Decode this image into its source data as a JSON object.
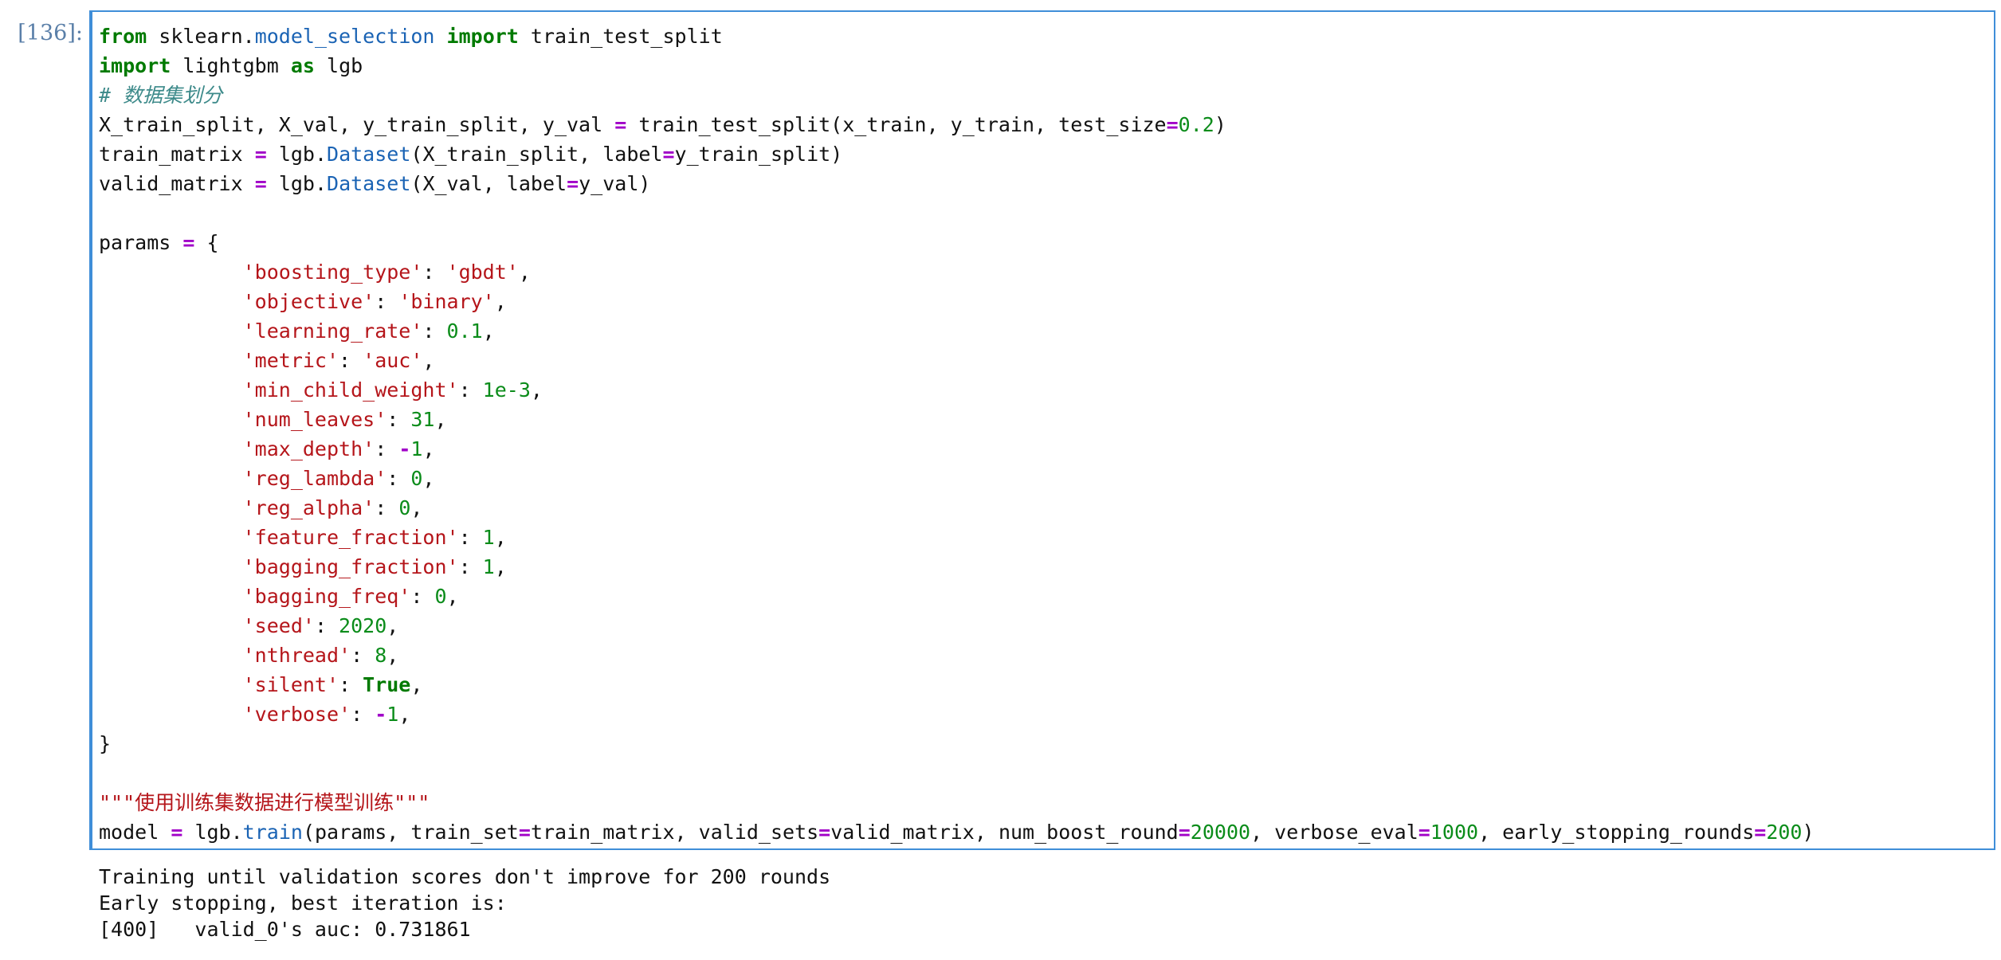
{
  "cell": {
    "prompt": "[136]:",
    "line1": {
      "kw_from": "from",
      "mod_a": "sklearn.",
      "mod_b": "model_selection",
      "kw_import": "import",
      "name": "train_test_split"
    },
    "line2": {
      "kw_import": "import",
      "name": "lightgbm",
      "kw_as": "as",
      "alias": "lgb"
    },
    "line3": {
      "comment": "# 数据集划分"
    },
    "line4": {
      "a": "X_train_split, X_val, y_train_split, y_val",
      "eq": "=",
      "b": "train_test_split(x_train, y_train, test_size",
      "eq2": "=",
      "num": "0.2",
      "c": ")"
    },
    "line5": {
      "a": "train_matrix",
      "eq": "=",
      "b": "lgb.",
      "fn": "Dataset",
      "c": "(X_train_split, label",
      "eq2": "=",
      "d": "y_train_split)"
    },
    "line6": {
      "a": "valid_matrix",
      "eq": "=",
      "b": "lgb.",
      "fn": "Dataset",
      "c": "(X_val, label",
      "eq2": "=",
      "d": "y_val)"
    },
    "params_head": {
      "a": "params",
      "eq": "=",
      "b": "{"
    },
    "params": [
      {
        "key": "'boosting_type'",
        "val": "'gbdt'",
        "type": "str"
      },
      {
        "key": "'objective'",
        "val": "'binary'",
        "type": "str"
      },
      {
        "key": "'learning_rate'",
        "val": "0.1",
        "type": "num"
      },
      {
        "key": "'metric'",
        "val": "'auc'",
        "type": "str"
      },
      {
        "key": "'min_child_weight'",
        "val": "1e-3",
        "type": "num"
      },
      {
        "key": "'num_leaves'",
        "val": "31",
        "type": "num"
      },
      {
        "key": "'max_depth'",
        "val": "-1",
        "type": "neg"
      },
      {
        "key": "'reg_lambda'",
        "val": "0",
        "type": "num"
      },
      {
        "key": "'reg_alpha'",
        "val": "0",
        "type": "num"
      },
      {
        "key": "'feature_fraction'",
        "val": "1",
        "type": "num"
      },
      {
        "key": "'bagging_fraction'",
        "val": "1",
        "type": "num"
      },
      {
        "key": "'bagging_freq'",
        "val": "0",
        "type": "num"
      },
      {
        "key": "'seed'",
        "val": "2020",
        "type": "num"
      },
      {
        "key": "'nthread'",
        "val": "8",
        "type": "num"
      },
      {
        "key": "'silent'",
        "val": "True",
        "type": "kw"
      },
      {
        "key": "'verbose'",
        "val": "-1",
        "type": "neg"
      }
    ],
    "params_close": "}",
    "docstring": "\"\"\"使用训练集数据进行模型训练\"\"\"",
    "train_line": {
      "a": "model",
      "eq": "=",
      "b": "lgb.",
      "fn": "train",
      "c": "(params, train_set",
      "eq2": "=",
      "d": "train_matrix, valid_sets",
      "eq3": "=",
      "e": "valid_matrix, num_boost_round",
      "eq4": "=",
      "n1": "20000",
      "f": ", verbose_eval",
      "eq5": "=",
      "n2": "1000",
      "g": ", early_stopping_rounds",
      "eq6": "=",
      "n3": "200",
      "h": ")"
    }
  },
  "output": {
    "lines": [
      "Training until validation scores don't improve for 200 rounds",
      "Early stopping, best iteration is:",
      "[400]\tvalid_0's auc: 0.731861"
    ]
  }
}
